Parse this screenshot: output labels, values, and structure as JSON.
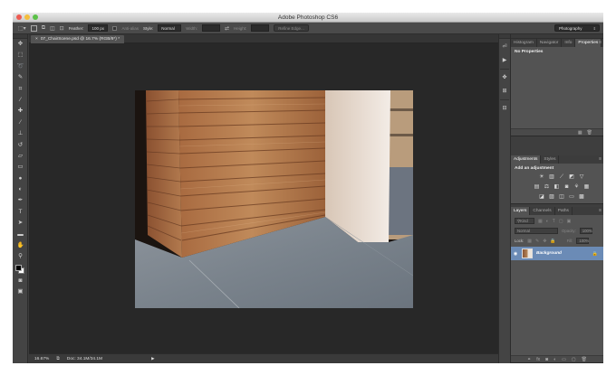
{
  "window": {
    "title": "Adobe Photoshop CS6"
  },
  "options_bar": {
    "feather_label": "Feather:",
    "feather_value": "100 px",
    "anti_alias_label": "Anti-alias",
    "style_label": "Style:",
    "style_value": "Normal",
    "width_label": "Width:",
    "height_label": "Height:",
    "refine_edge_label": "Refine Edge...",
    "workspace_value": "Photography"
  },
  "document": {
    "tab_title": "07_ChairScene.psd @ 16.7% (RGB/8*) *",
    "zoom": "16.67%",
    "doc_size": "Doc: 34.1M/34.1M"
  },
  "panels": {
    "info_group": {
      "tabs": [
        "Histogram",
        "Navigator",
        "Info",
        "Properties"
      ],
      "active": "Properties",
      "heading": "No Properties"
    },
    "adjust_group": {
      "tabs": [
        "Adjustments",
        "Styles"
      ],
      "active": "Adjustments",
      "heading": "Add an adjustment"
    },
    "layers_group": {
      "tabs": [
        "Layers",
        "Channels",
        "Paths"
      ],
      "active": "Layers",
      "kind_filter": "Kind",
      "blend_mode": "Normal",
      "opacity_label": "Opacity:",
      "opacity_value": "100%",
      "lock_label": "Lock:",
      "fill_label": "Fill:",
      "fill_value": "100%",
      "layers": [
        {
          "name": "Background",
          "visible": true,
          "locked": true
        }
      ]
    }
  },
  "colors": {
    "foreground": "#000000",
    "background": "#ffffff",
    "selected_layer": "#6b8bb6"
  }
}
